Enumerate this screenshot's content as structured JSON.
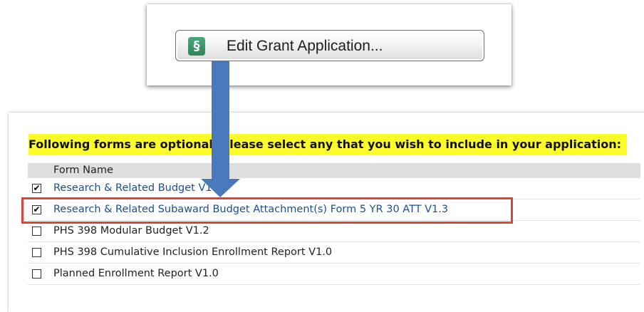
{
  "button": {
    "label": "Edit Grant Application...",
    "icon_glyph": "§",
    "icon": "grant-dollar-icon",
    "icon_color": "#2b8659"
  },
  "forms": {
    "prompt": "Following forms are optional. Please select any that you wish to include in your application:",
    "column_header": "Form Name",
    "rows": [
      {
        "label": "Research & Related Budget V1.3",
        "checked": true,
        "link": true
      },
      {
        "label": "Research & Related Subaward Budget Attachment(s) Form 5 YR 30 ATT V1.3",
        "checked": true,
        "link": true
      },
      {
        "label": "PHS 398 Modular Budget V1.2",
        "checked": false,
        "link": false
      },
      {
        "label": "PHS 398 Cumulative Inclusion Enrollment Report V1.0",
        "checked": false,
        "link": false
      },
      {
        "label": "Planned Enrollment Report V1.0",
        "checked": false,
        "link": false
      }
    ],
    "check_glyph": "✔",
    "highlight_color": "#e0413a",
    "prompt_bg": "#fbfb2c",
    "arrow_color": "#4a78bc"
  }
}
